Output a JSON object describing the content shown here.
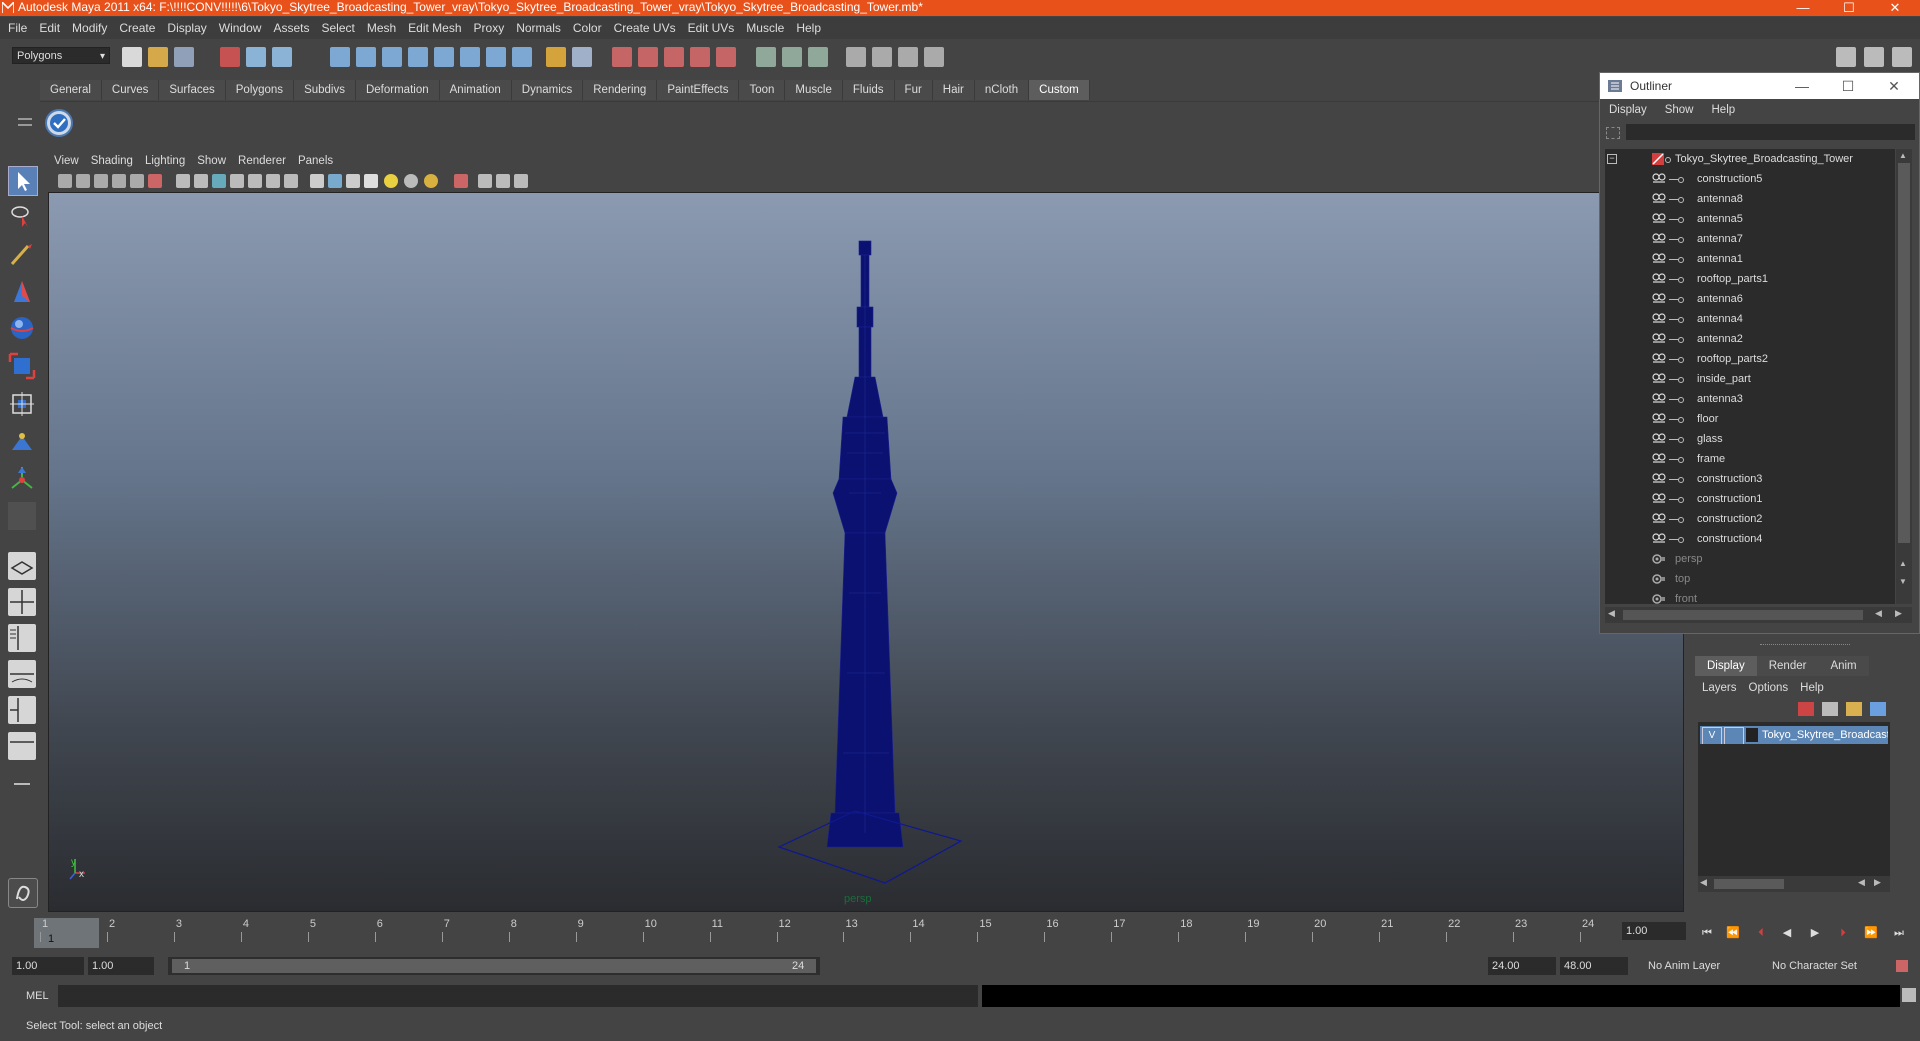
{
  "window": {
    "title": "Autodesk Maya 2011 x64: F:\\!!!!CONV!!!!!\\6\\Tokyo_Skytree_Broadcasting_Tower_vray\\Tokyo_Skytree_Broadcasting_Tower_vray\\Tokyo_Skytree_Broadcasting_Tower.mb*",
    "minimize": "—",
    "maximize": "☐",
    "close": "✕"
  },
  "menubar": [
    "File",
    "Edit",
    "Modify",
    "Create",
    "Display",
    "Window",
    "Assets",
    "Select",
    "Mesh",
    "Edit Mesh",
    "Proxy",
    "Normals",
    "Color",
    "Create UVs",
    "Edit UVs",
    "Muscle",
    "Help"
  ],
  "status_line": {
    "mode": "Polygons"
  },
  "shelf": {
    "tabs": [
      "General",
      "Curves",
      "Surfaces",
      "Polygons",
      "Subdivs",
      "Deformation",
      "Animation",
      "Dynamics",
      "Rendering",
      "PaintEffects",
      "Toon",
      "Muscle",
      "Fluids",
      "Fur",
      "Hair",
      "nCloth",
      "Custom"
    ],
    "active": "Custom"
  },
  "viewport": {
    "menu": [
      "View",
      "Shading",
      "Lighting",
      "Show",
      "Renderer",
      "Panels"
    ],
    "camera": "persp",
    "axis_x": "x",
    "axis_y": "y",
    "model_color": "#0b1170"
  },
  "outliner": {
    "title": "Outliner",
    "menu": [
      "Display",
      "Show",
      "Help"
    ],
    "root": "Tokyo_Skytree_Broadcasting_Tower",
    "children": [
      "construction5",
      "antenna8",
      "antenna5",
      "antenna7",
      "antenna1",
      "rooftop_parts1",
      "antenna6",
      "antenna4",
      "antenna2",
      "rooftop_parts2",
      "inside_part",
      "antenna3",
      "floor",
      "glass",
      "frame",
      "construction3",
      "construction1",
      "construction2",
      "construction4"
    ],
    "cameras": [
      "persp",
      "top",
      "front"
    ]
  },
  "layer_editor": {
    "tabs": [
      "Display",
      "Render",
      "Anim"
    ],
    "active_tab": "Display",
    "menu": [
      "Layers",
      "Options",
      "Help"
    ],
    "layer": {
      "visible": "V",
      "name": "Tokyo_Skytree_Broadcasting_Tower"
    }
  },
  "time_slider": {
    "frames": [
      "1",
      "2",
      "3",
      "4",
      "5",
      "6",
      "7",
      "8",
      "9",
      "10",
      "11",
      "12",
      "13",
      "14",
      "15",
      "16",
      "17",
      "18",
      "19",
      "20",
      "21",
      "22",
      "23",
      "24"
    ],
    "current_frame": "1",
    "current_time": "1.00"
  },
  "range_slider": {
    "start": "1.00",
    "inner_start": "1.00",
    "bar_start": "1",
    "bar_end": "24",
    "end": "24.00",
    "outer_end": "48.00",
    "anim_layer": "No Anim Layer",
    "char_set": "No Character Set"
  },
  "command_line": {
    "label": "MEL"
  },
  "help_line": "Select Tool: select an object"
}
